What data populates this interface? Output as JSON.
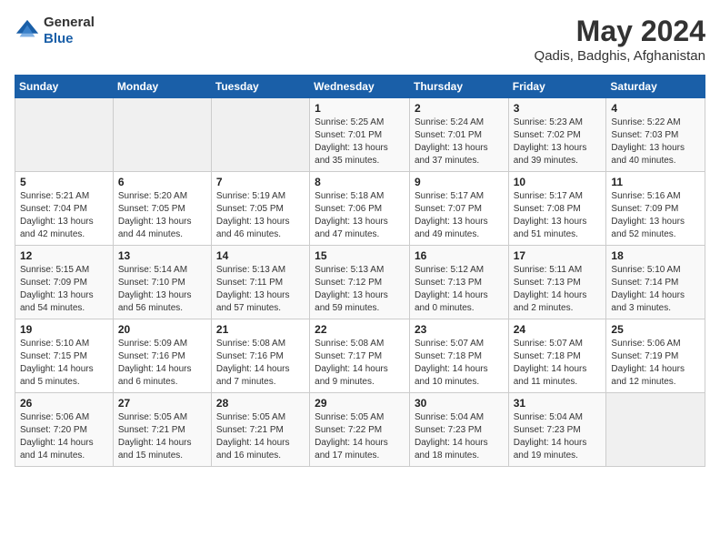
{
  "header": {
    "logo": {
      "general": "General",
      "blue": "Blue"
    },
    "title": "May 2024",
    "location": "Qadis, Badghis, Afghanistan"
  },
  "weekdays": [
    "Sunday",
    "Monday",
    "Tuesday",
    "Wednesday",
    "Thursday",
    "Friday",
    "Saturday"
  ],
  "weeks": [
    [
      {
        "day": "",
        "info": ""
      },
      {
        "day": "",
        "info": ""
      },
      {
        "day": "",
        "info": ""
      },
      {
        "day": "1",
        "info": "Sunrise: 5:25 AM\nSunset: 7:01 PM\nDaylight: 13 hours\nand 35 minutes."
      },
      {
        "day": "2",
        "info": "Sunrise: 5:24 AM\nSunset: 7:01 PM\nDaylight: 13 hours\nand 37 minutes."
      },
      {
        "day": "3",
        "info": "Sunrise: 5:23 AM\nSunset: 7:02 PM\nDaylight: 13 hours\nand 39 minutes."
      },
      {
        "day": "4",
        "info": "Sunrise: 5:22 AM\nSunset: 7:03 PM\nDaylight: 13 hours\nand 40 minutes."
      }
    ],
    [
      {
        "day": "5",
        "info": "Sunrise: 5:21 AM\nSunset: 7:04 PM\nDaylight: 13 hours\nand 42 minutes."
      },
      {
        "day": "6",
        "info": "Sunrise: 5:20 AM\nSunset: 7:05 PM\nDaylight: 13 hours\nand 44 minutes."
      },
      {
        "day": "7",
        "info": "Sunrise: 5:19 AM\nSunset: 7:05 PM\nDaylight: 13 hours\nand 46 minutes."
      },
      {
        "day": "8",
        "info": "Sunrise: 5:18 AM\nSunset: 7:06 PM\nDaylight: 13 hours\nand 47 minutes."
      },
      {
        "day": "9",
        "info": "Sunrise: 5:17 AM\nSunset: 7:07 PM\nDaylight: 13 hours\nand 49 minutes."
      },
      {
        "day": "10",
        "info": "Sunrise: 5:17 AM\nSunset: 7:08 PM\nDaylight: 13 hours\nand 51 minutes."
      },
      {
        "day": "11",
        "info": "Sunrise: 5:16 AM\nSunset: 7:09 PM\nDaylight: 13 hours\nand 52 minutes."
      }
    ],
    [
      {
        "day": "12",
        "info": "Sunrise: 5:15 AM\nSunset: 7:09 PM\nDaylight: 13 hours\nand 54 minutes."
      },
      {
        "day": "13",
        "info": "Sunrise: 5:14 AM\nSunset: 7:10 PM\nDaylight: 13 hours\nand 56 minutes."
      },
      {
        "day": "14",
        "info": "Sunrise: 5:13 AM\nSunset: 7:11 PM\nDaylight: 13 hours\nand 57 minutes."
      },
      {
        "day": "15",
        "info": "Sunrise: 5:13 AM\nSunset: 7:12 PM\nDaylight: 13 hours\nand 59 minutes."
      },
      {
        "day": "16",
        "info": "Sunrise: 5:12 AM\nSunset: 7:13 PM\nDaylight: 14 hours\nand 0 minutes."
      },
      {
        "day": "17",
        "info": "Sunrise: 5:11 AM\nSunset: 7:13 PM\nDaylight: 14 hours\nand 2 minutes."
      },
      {
        "day": "18",
        "info": "Sunrise: 5:10 AM\nSunset: 7:14 PM\nDaylight: 14 hours\nand 3 minutes."
      }
    ],
    [
      {
        "day": "19",
        "info": "Sunrise: 5:10 AM\nSunset: 7:15 PM\nDaylight: 14 hours\nand 5 minutes."
      },
      {
        "day": "20",
        "info": "Sunrise: 5:09 AM\nSunset: 7:16 PM\nDaylight: 14 hours\nand 6 minutes."
      },
      {
        "day": "21",
        "info": "Sunrise: 5:08 AM\nSunset: 7:16 PM\nDaylight: 14 hours\nand 7 minutes."
      },
      {
        "day": "22",
        "info": "Sunrise: 5:08 AM\nSunset: 7:17 PM\nDaylight: 14 hours\nand 9 minutes."
      },
      {
        "day": "23",
        "info": "Sunrise: 5:07 AM\nSunset: 7:18 PM\nDaylight: 14 hours\nand 10 minutes."
      },
      {
        "day": "24",
        "info": "Sunrise: 5:07 AM\nSunset: 7:18 PM\nDaylight: 14 hours\nand 11 minutes."
      },
      {
        "day": "25",
        "info": "Sunrise: 5:06 AM\nSunset: 7:19 PM\nDaylight: 14 hours\nand 12 minutes."
      }
    ],
    [
      {
        "day": "26",
        "info": "Sunrise: 5:06 AM\nSunset: 7:20 PM\nDaylight: 14 hours\nand 14 minutes."
      },
      {
        "day": "27",
        "info": "Sunrise: 5:05 AM\nSunset: 7:21 PM\nDaylight: 14 hours\nand 15 minutes."
      },
      {
        "day": "28",
        "info": "Sunrise: 5:05 AM\nSunset: 7:21 PM\nDaylight: 14 hours\nand 16 minutes."
      },
      {
        "day": "29",
        "info": "Sunrise: 5:05 AM\nSunset: 7:22 PM\nDaylight: 14 hours\nand 17 minutes."
      },
      {
        "day": "30",
        "info": "Sunrise: 5:04 AM\nSunset: 7:23 PM\nDaylight: 14 hours\nand 18 minutes."
      },
      {
        "day": "31",
        "info": "Sunrise: 5:04 AM\nSunset: 7:23 PM\nDaylight: 14 hours\nand 19 minutes."
      },
      {
        "day": "",
        "info": ""
      }
    ]
  ]
}
